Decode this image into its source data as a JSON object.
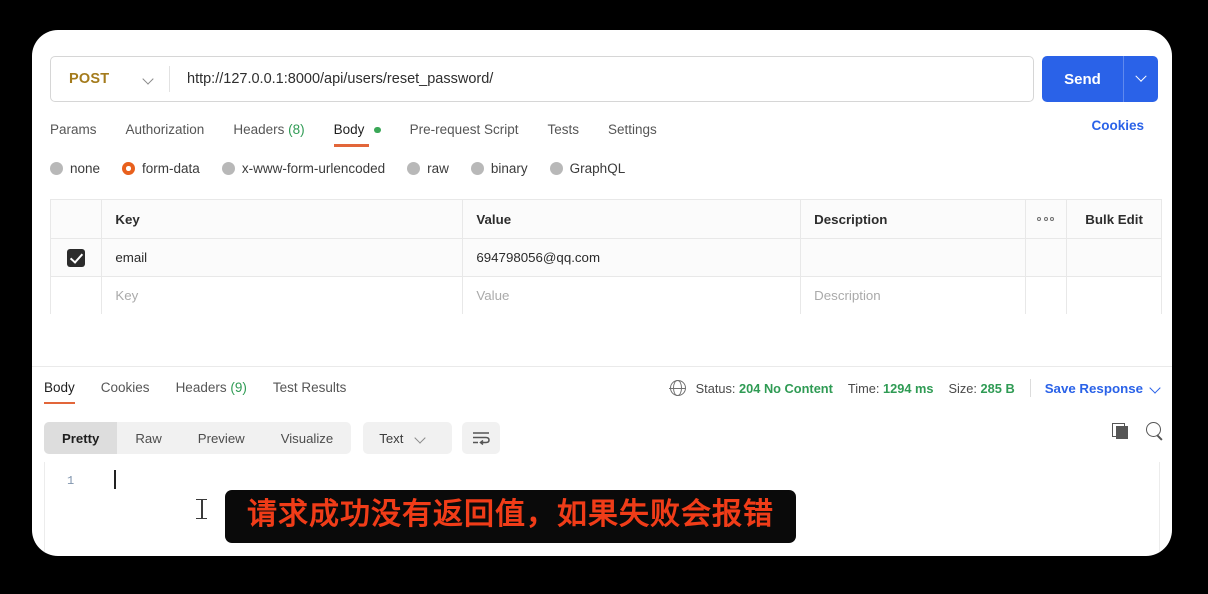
{
  "request": {
    "method": "POST",
    "method_chevron_icon": "chevron-down-icon",
    "url": "http://127.0.0.1:8000/api/users/reset_password/",
    "send_label": "Send",
    "send_chevron_icon": "chevron-down-icon",
    "tabs": [
      {
        "label": "Params",
        "active": false
      },
      {
        "label": "Authorization",
        "active": false
      },
      {
        "label": "Headers",
        "count": "(8)",
        "active": false
      },
      {
        "label": "Body",
        "dot": true,
        "active": true
      },
      {
        "label": "Pre-request Script",
        "active": false
      },
      {
        "label": "Tests",
        "active": false
      },
      {
        "label": "Settings",
        "active": false
      }
    ],
    "cookies_label": "Cookies",
    "body_types": [
      {
        "label": "none",
        "selected": false
      },
      {
        "label": "form-data",
        "selected": true
      },
      {
        "label": "x-www-form-urlencoded",
        "selected": false
      },
      {
        "label": "raw",
        "selected": false
      },
      {
        "label": "binary",
        "selected": false
      },
      {
        "label": "GraphQL",
        "selected": false
      }
    ],
    "table": {
      "headers": {
        "key": "Key",
        "value": "Value",
        "description": "Description",
        "more_icon": "ellipsis-icon",
        "bulk_edit": "Bulk Edit"
      },
      "rows": [
        {
          "checked": true,
          "key": "email",
          "value": "694798056@qq.com",
          "description": ""
        }
      ],
      "placeholders": {
        "key": "Key",
        "value": "Value",
        "description": "Description"
      }
    }
  },
  "response": {
    "tabs": [
      {
        "label": "Body",
        "active": true
      },
      {
        "label": "Cookies",
        "active": false
      },
      {
        "label": "Headers",
        "count": "(9)",
        "active": false
      },
      {
        "label": "Test Results",
        "active": false
      }
    ],
    "status": {
      "globe_icon": "globe-icon",
      "status_label": "Status:",
      "status_value": "204 No Content",
      "time_label": "Time:",
      "time_value": "1294 ms",
      "size_label": "Size:",
      "size_value": "285 B",
      "save_response": "Save Response",
      "save_chevron_icon": "chevron-down-icon"
    },
    "viewer": {
      "modes": [
        {
          "label": "Pretty",
          "active": true
        },
        {
          "label": "Raw",
          "active": false
        },
        {
          "label": "Preview",
          "active": false
        },
        {
          "label": "Visualize",
          "active": false
        }
      ],
      "format": "Text",
      "format_chevron_icon": "chevron-down-icon",
      "wrap_icon": "wrap-lines-icon",
      "copy_icon": "copy-icon",
      "search_icon": "search-icon"
    },
    "editor": {
      "line_number": "1",
      "content": "",
      "caret_icon": "text-caret",
      "cursor_icon": "i-beam-cursor"
    },
    "annotation": "请求成功没有返回值，如果失败会报错"
  },
  "colors": {
    "accent_blue": "#2a62e8",
    "accent_orange": "#e2663a",
    "method_gold": "#a47b1c",
    "success_green": "#2f9b54",
    "radio_selected": "#e8601d",
    "annotation_text": "#f03c18",
    "annotation_bg": "#0a0a0a"
  }
}
